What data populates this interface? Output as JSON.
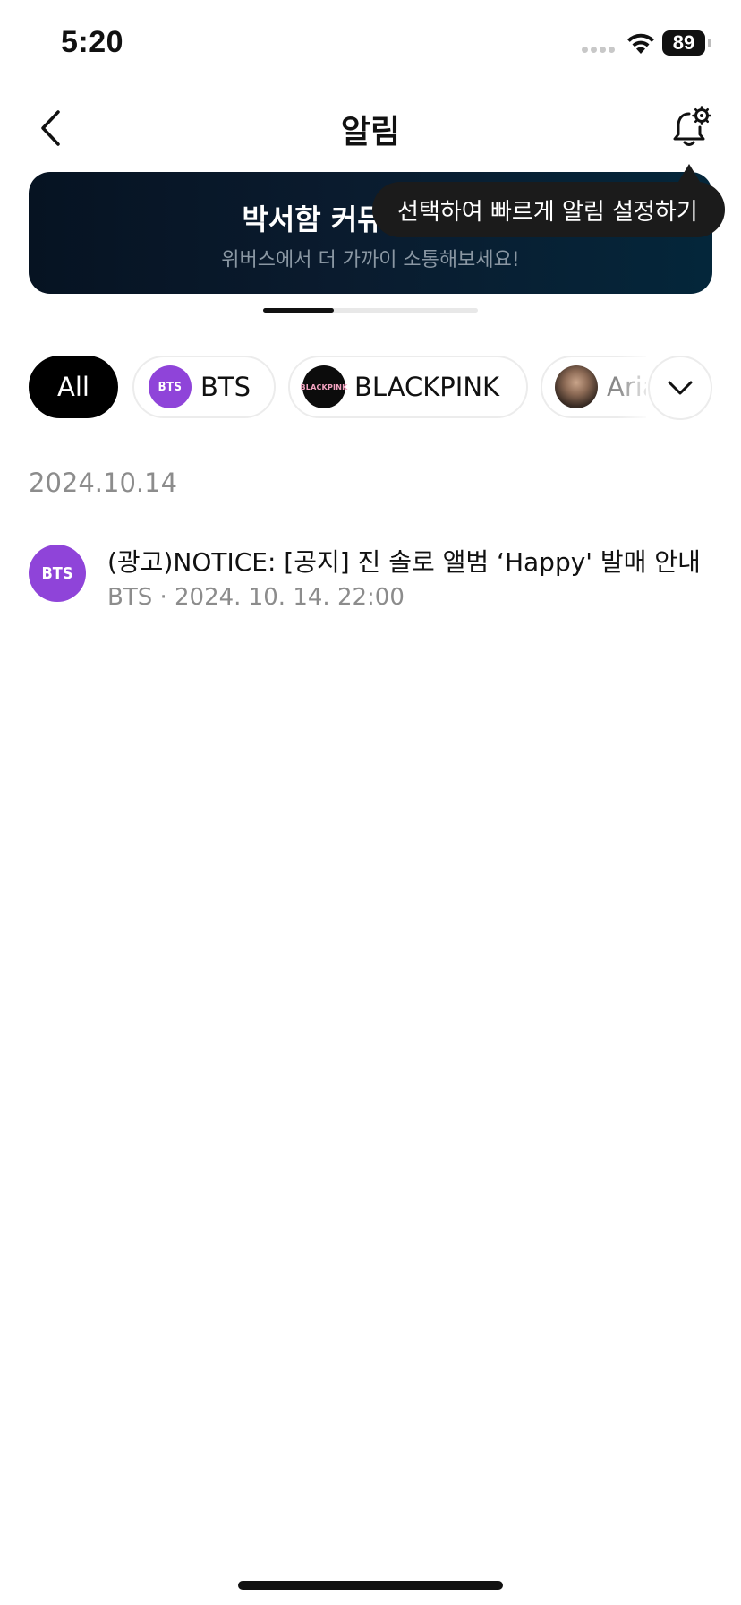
{
  "status_bar": {
    "time": "5:20",
    "battery": "89"
  },
  "header": {
    "title": "알림",
    "back_icon": "chevron-left-icon",
    "settings_icon": "bell-gear-icon"
  },
  "banner": {
    "title": "박서함 커뮤니티 오픈",
    "subtitle": "위버스에서 더 가까이 소통해보세요!",
    "page_progress": 0.33
  },
  "tooltip": {
    "text": "선택하여 빠르게 알림 설정하기"
  },
  "filters": {
    "chips": [
      {
        "label": "All",
        "selected": true
      },
      {
        "label": "BTS",
        "avatar_text": "BTS"
      },
      {
        "label": "BLACKPINK",
        "avatar_text": "BLACKPINK"
      },
      {
        "label": "Aria"
      }
    ],
    "expand_icon": "chevron-down-icon"
  },
  "notifications": {
    "date": "2024.10.14",
    "items": [
      {
        "avatar_text": "BTS",
        "title": "(광고)NOTICE: [공지] 진 솔로 앨범 ‘Happy' 발매 안내",
        "meta": "BTS · 2024. 10. 14. 22:00"
      }
    ]
  },
  "colors": {
    "bts_purple": "#8f44d9",
    "banner_dark": "#061322",
    "tooltip_bg": "#1b1b1b",
    "muted_text": "#8c8c8c"
  }
}
